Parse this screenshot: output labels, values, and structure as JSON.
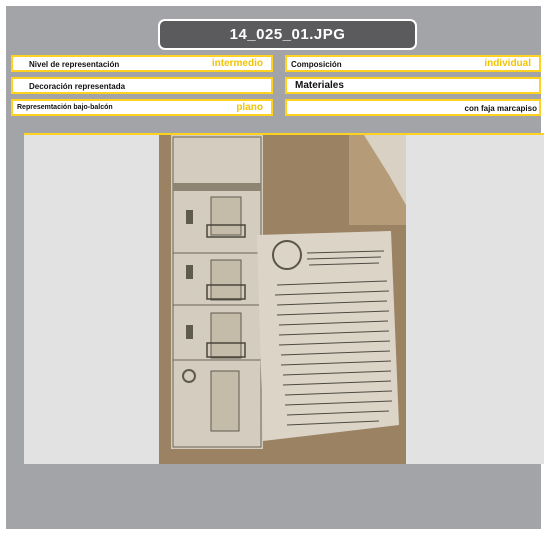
{
  "title": "14_025_01.JPG",
  "fields": {
    "nivel": {
      "label": "Nivel de representación",
      "value": "intermedio"
    },
    "composicion": {
      "label": "Composición",
      "value": "individual"
    },
    "decoracion": {
      "label": "Decoración representada"
    },
    "materiales": {
      "label": "Materiales"
    },
    "bajo_balcon": {
      "label": "Represemtación bajo-balcón",
      "value": "plano"
    },
    "faja": {
      "value": "con faja marcapiso"
    }
  },
  "colors": {
    "panel": "#a3a4a7",
    "title_bg": "#5b5b5e",
    "field_border": "#ffd21f",
    "value_text": "#f2c400"
  },
  "image": {
    "icon": "document-photo"
  }
}
